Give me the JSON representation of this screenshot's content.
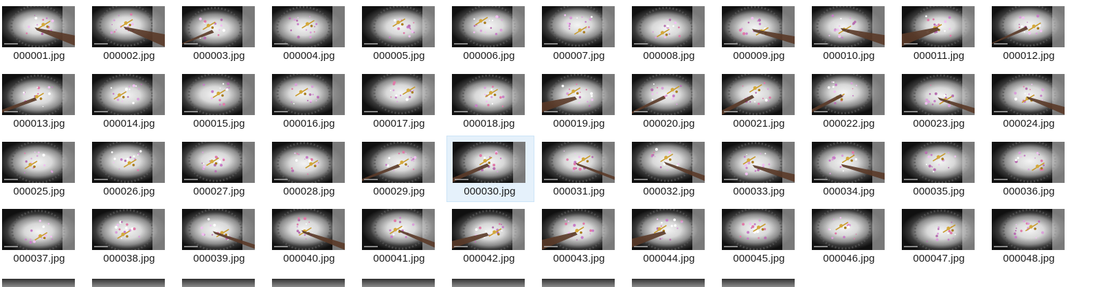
{
  "window": {
    "view": "large-icons",
    "selected_file": "000030.jpg"
  },
  "colors": {
    "selection_fill": "#e5f1fb",
    "selection_border": "#cce4f7",
    "label_text": "#1a1a1a",
    "background": "#ffffff"
  },
  "icon": "image-thumbnail",
  "files": [
    {
      "name": "000001.jpg"
    },
    {
      "name": "000002.jpg"
    },
    {
      "name": "000003.jpg"
    },
    {
      "name": "000004.jpg"
    },
    {
      "name": "000005.jpg"
    },
    {
      "name": "000006.jpg"
    },
    {
      "name": "000007.jpg"
    },
    {
      "name": "000008.jpg"
    },
    {
      "name": "000009.jpg"
    },
    {
      "name": "000010.jpg"
    },
    {
      "name": "000011.jpg"
    },
    {
      "name": "000012.jpg"
    },
    {
      "name": "000013.jpg"
    },
    {
      "name": "000014.jpg"
    },
    {
      "name": "000015.jpg"
    },
    {
      "name": "000016.jpg"
    },
    {
      "name": "000017.jpg"
    },
    {
      "name": "000018.jpg"
    },
    {
      "name": "000019.jpg"
    },
    {
      "name": "000020.jpg"
    },
    {
      "name": "000021.jpg"
    },
    {
      "name": "000022.jpg"
    },
    {
      "name": "000023.jpg"
    },
    {
      "name": "000024.jpg"
    },
    {
      "name": "000025.jpg"
    },
    {
      "name": "000026.jpg"
    },
    {
      "name": "000027.jpg"
    },
    {
      "name": "000028.jpg"
    },
    {
      "name": "000029.jpg"
    },
    {
      "name": "000030.jpg",
      "selected": true
    },
    {
      "name": "000031.jpg"
    },
    {
      "name": "000032.jpg"
    },
    {
      "name": "000033.jpg"
    },
    {
      "name": "000034.jpg"
    },
    {
      "name": "000035.jpg"
    },
    {
      "name": "000036.jpg"
    },
    {
      "name": "000037.jpg"
    },
    {
      "name": "000038.jpg"
    },
    {
      "name": "000039.jpg"
    },
    {
      "name": "000040.jpg"
    },
    {
      "name": "000041.jpg"
    },
    {
      "name": "000042.jpg"
    },
    {
      "name": "000043.jpg"
    },
    {
      "name": "000044.jpg"
    },
    {
      "name": "000045.jpg"
    },
    {
      "name": "000046.jpg"
    },
    {
      "name": "000047.jpg"
    },
    {
      "name": "000048.jpg"
    }
  ]
}
